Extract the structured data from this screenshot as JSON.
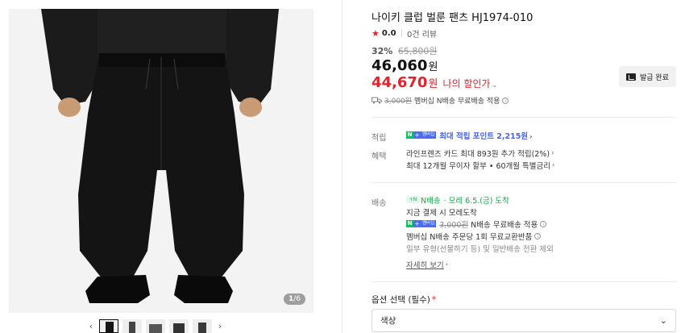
{
  "product": {
    "title": "나이키 클럽 벌룬 팬츠 HJ1974-010",
    "rating": "0.0",
    "reviews": "0건 리뷰",
    "discount_rate": "32%",
    "original_price": "65,800원",
    "price": "46,060",
    "price_unit": "원",
    "my_price": "44,670",
    "my_price_unit": "원",
    "my_price_label": "나의 할인가",
    "coupon_button": "발급 완료"
  },
  "shipping_summary": {
    "struck_fee": "3,000원",
    "text": "멤버십 N배송 무료배송 적용"
  },
  "gallery": {
    "counter_current": "1",
    "counter_total": "/6"
  },
  "points": {
    "label": "적립",
    "badge_n": "N",
    "badge_plus": "+",
    "badge_membership": "멤버십",
    "link_text": "최대 적립 포인트 2,215원"
  },
  "benefits": {
    "label": "혜택",
    "line1": "라인프렌즈 카드 최대 893원 추가 적립(2%)",
    "line2": "최대 12개월 무이자 할부 • 60개월 특별금리"
  },
  "delivery": {
    "label": "배송",
    "today_tag": "N배송",
    "arrival": "· 모레 6.5.(금) 도착",
    "line2": "지금 결제 시 모레도착",
    "line3_struck": "3,000원",
    "line3_text": "N배송 무료배송 적용",
    "line4": "멤버십 N배송 주문당 1회 무료교환반품",
    "line5": "일부 유형(선물하기 등) 및 일반배송 전환 제외",
    "details_link": "자세히 보기"
  },
  "options": {
    "label": "옵션 선택 (필수)",
    "required_mark": "*",
    "select_value": "색상"
  },
  "colors": {
    "accent_red": "#e8202a",
    "naver_green": "#03c75a",
    "points_blue": "#4a63e6"
  }
}
